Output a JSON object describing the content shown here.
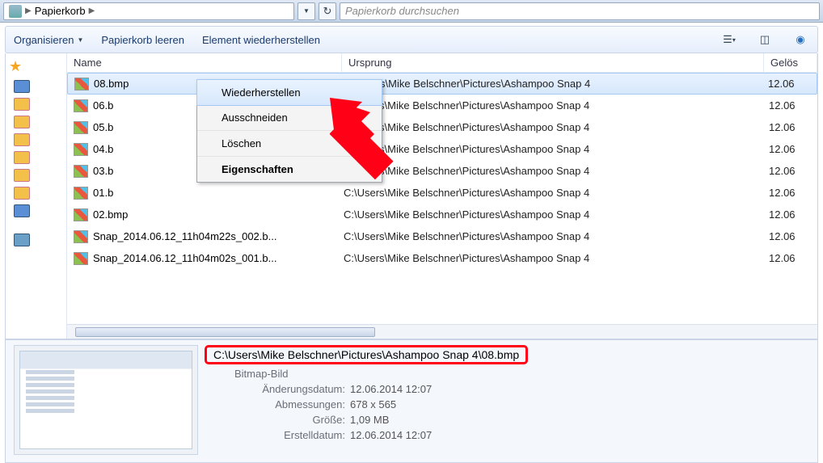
{
  "breadcrumb": {
    "location": "Papierkorb"
  },
  "search": {
    "placeholder": "Papierkorb durchsuchen"
  },
  "toolbar": {
    "organize": "Organisieren",
    "empty": "Papierkorb leeren",
    "restore": "Element wiederherstellen"
  },
  "columns": {
    "name": "Name",
    "origin": "Ursprung",
    "deleted": "Gelös"
  },
  "files": [
    {
      "name": "08.bmp",
      "origin": "C:\\Users\\Mike Belschner\\Pictures\\Ashampoo Snap 4",
      "deleted": "12.06",
      "selected": true
    },
    {
      "name": "06.b",
      "origin": "C:\\Users\\Mike Belschner\\Pictures\\Ashampoo Snap 4",
      "deleted": "12.06"
    },
    {
      "name": "05.b",
      "origin": "C:\\Users\\Mike Belschner\\Pictures\\Ashampoo Snap 4",
      "deleted": "12.06"
    },
    {
      "name": "04.b",
      "origin": "C:\\Users\\Mike Belschner\\Pictures\\Ashampoo Snap 4",
      "deleted": "12.06"
    },
    {
      "name": "03.b",
      "origin": "C:\\Users\\Mike Belschner\\Pictures\\Ashampoo Snap 4",
      "deleted": "12.06"
    },
    {
      "name": "01.b",
      "origin": "C:\\Users\\Mike Belschner\\Pictures\\Ashampoo Snap 4",
      "deleted": "12.06"
    },
    {
      "name": "02.bmp",
      "origin": "C:\\Users\\Mike Belschner\\Pictures\\Ashampoo Snap 4",
      "deleted": "12.06"
    },
    {
      "name": "Snap_2014.06.12_11h04m22s_002.b...",
      "origin": "C:\\Users\\Mike Belschner\\Pictures\\Ashampoo Snap 4",
      "deleted": "12.06"
    },
    {
      "name": "Snap_2014.06.12_11h04m02s_001.b...",
      "origin": "C:\\Users\\Mike Belschner\\Pictures\\Ashampoo Snap 4",
      "deleted": "12.06"
    }
  ],
  "context_menu": {
    "restore": "Wiederherstellen",
    "cut": "Ausschneiden",
    "delete": "Löschen",
    "properties": "Eigenschaften"
  },
  "details": {
    "path": "C:\\Users\\Mike Belschner\\Pictures\\Ashampoo Snap 4\\08.bmp",
    "type": "Bitmap-Bild",
    "modified_label": "Änderungsdatum:",
    "modified": "12.06.2014 12:07",
    "dimensions_label": "Abmessungen:",
    "dimensions": "678 x 565",
    "size_label": "Größe:",
    "size": "1,09 MB",
    "created_label": "Erstelldatum:",
    "created": "12.06.2014 12:07"
  }
}
